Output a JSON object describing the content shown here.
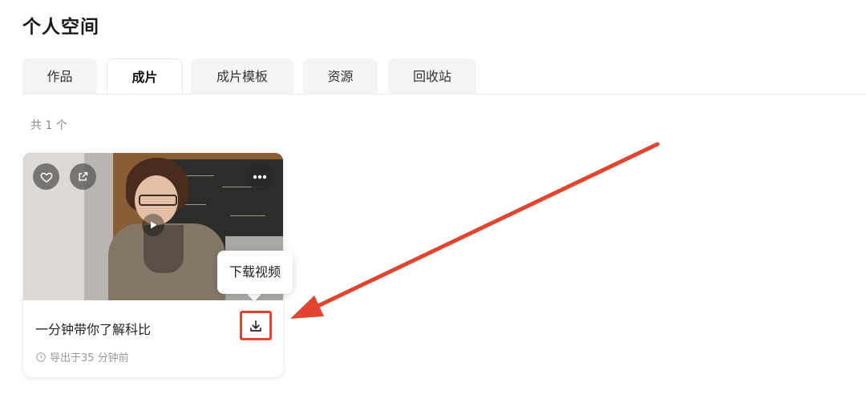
{
  "page": {
    "title": "个人空间"
  },
  "tabs": [
    {
      "label": "作品",
      "active": false
    },
    {
      "label": "成片",
      "active": true
    },
    {
      "label": "成片模板",
      "active": false
    },
    {
      "label": "资源",
      "active": false
    },
    {
      "label": "回收站",
      "active": false
    }
  ],
  "count_label": "共 1 个",
  "card": {
    "title": "一分钟带你了解科比",
    "meta": "导出于35 分钟前",
    "icons": {
      "favorite": "heart-icon",
      "share": "share-icon",
      "more": "more-icon",
      "play": "play-icon",
      "download": "download-icon",
      "time": "clock-icon"
    }
  },
  "tooltip": {
    "label": "下载视频"
  },
  "colors": {
    "annotation": "#e2442f"
  }
}
